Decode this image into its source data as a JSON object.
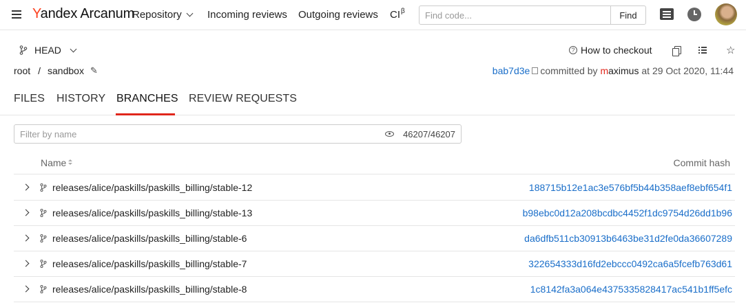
{
  "header": {
    "logo_brand": "Y",
    "logo_rest": "andex Arcanum",
    "nav": [
      {
        "label": "Repository"
      },
      {
        "label": "Incoming reviews"
      },
      {
        "label": "Outgoing reviews"
      },
      {
        "label": "CI",
        "sup": "β"
      }
    ],
    "search": {
      "placeholder": "Find code...",
      "value": "",
      "button_label": "Find"
    }
  },
  "branch_bar": {
    "ref": "HEAD",
    "how_to_checkout": "How to checkout"
  },
  "breadcrumb": {
    "root": "root",
    "separator": "/",
    "current": "sandbox"
  },
  "commit": {
    "hash": "bab7d3e",
    "committed_by": "committed by",
    "user_first": "m",
    "user_rest": "aximus",
    "at": "at 29 Oct 2020, 11:44"
  },
  "tabs": [
    {
      "label": "FILES"
    },
    {
      "label": "HISTORY"
    },
    {
      "label": "BRANCHES",
      "active": true
    },
    {
      "label": "REVIEW REQUESTS"
    }
  ],
  "filter": {
    "placeholder": "Filter by name",
    "value": "",
    "count": "46207/46207"
  },
  "table": {
    "col_name": "Name",
    "col_hash": "Commit hash",
    "rows": [
      {
        "name": "releases/alice/paskills/paskills_billing/stable-12",
        "hash": "188715b12e1ac3e576bf5b44b358aef8ebf654f1"
      },
      {
        "name": "releases/alice/paskills/paskills_billing/stable-13",
        "hash": "b98ebc0d12a208bcdbc4452f1dc9754d26dd1b96"
      },
      {
        "name": "releases/alice/paskills/paskills_billing/stable-6",
        "hash": "da6dfb511cb30913b6463be31d2fe0da36607289"
      },
      {
        "name": "releases/alice/paskills/paskills_billing/stable-7",
        "hash": "322654333d16fd2ebccc0492ca6a5fcefb763d61"
      },
      {
        "name": "releases/alice/paskills/paskills_billing/stable-8",
        "hash": "1c8142fa3a064e4375335828417ac541b1ff5efc"
      }
    ]
  },
  "colors": {
    "accent": "#e0261b",
    "link": "#1a6ec9",
    "brand_y": "#fc3f1d"
  },
  "icons": [
    "menu-icon",
    "chevron-down-icon",
    "list-icon",
    "clock-icon",
    "branch-icon",
    "question-icon",
    "copy-icon",
    "bullet-list-icon",
    "star-icon",
    "pencil-icon",
    "eye-icon",
    "sort-icon",
    "chevron-right-icon"
  ]
}
